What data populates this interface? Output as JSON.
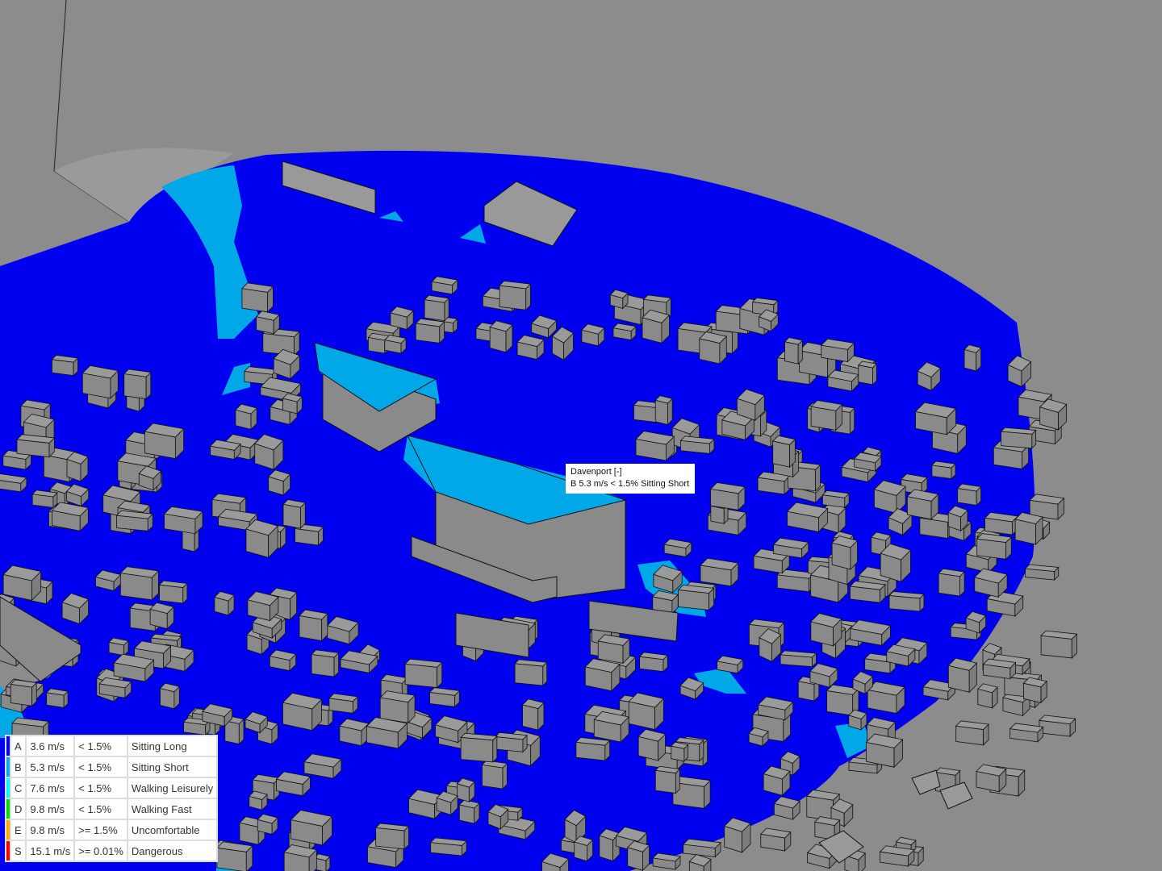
{
  "tooltip": {
    "title": "Davenport [-]",
    "value": "B 5.3 m/s < 1.5% Sitting Short"
  },
  "legend": [
    {
      "code": "A",
      "speed": "3.6 m/s",
      "prob": "< 1.5%",
      "label": "Sitting Long",
      "color": "#0000ff"
    },
    {
      "code": "B",
      "speed": "5.3 m/s",
      "prob": "< 1.5%",
      "label": "Sitting Short",
      "color": "#00aaee"
    },
    {
      "code": "C",
      "speed": "7.6 m/s",
      "prob": "< 1.5%",
      "label": "Walking Leisurely",
      "color": "#00ffff"
    },
    {
      "code": "D",
      "speed": "9.8 m/s",
      "prob": "< 1.5%",
      "label": "Walking Fast",
      "color": "#00dd00"
    },
    {
      "code": "E",
      "speed": "9.8 m/s",
      "prob": ">= 1.5%",
      "label": "Uncomfortable",
      "color": "#ffaa00"
    },
    {
      "code": "S",
      "speed": "15.1 m/s",
      "prob": ">= 0.01%",
      "label": "Dangerous",
      "color": "#ff0000"
    }
  ],
  "colors": {
    "background": "#8c8c8c",
    "ground": "#0000f0",
    "sitting_short": "#00a8e8",
    "building": "#8f8f8f"
  }
}
